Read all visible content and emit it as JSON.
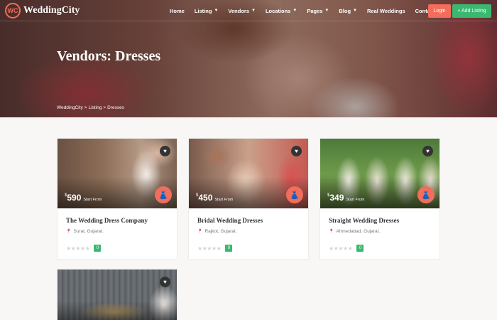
{
  "brand": {
    "name": "WeddingCity",
    "mark": "WC"
  },
  "nav": {
    "items": [
      {
        "label": "Home",
        "has_dropdown": false
      },
      {
        "label": "Listing",
        "has_dropdown": true
      },
      {
        "label": "Vendors",
        "has_dropdown": true
      },
      {
        "label": "Locations",
        "has_dropdown": true
      },
      {
        "label": "Pages",
        "has_dropdown": true
      },
      {
        "label": "Blog",
        "has_dropdown": true
      },
      {
        "label": "Real Weddings",
        "has_dropdown": false
      },
      {
        "label": "Contact Us",
        "has_dropdown": false
      }
    ],
    "login_label": "Login",
    "add_listing_label": "+ Add Listing"
  },
  "hero": {
    "title": "Vendors: Dresses",
    "breadcrumb": [
      "WeddingCity",
      ">",
      "Listing",
      ">",
      "Dresses"
    ]
  },
  "listings": [
    {
      "title": "The Wedding Dress Company",
      "location": "Surat, Gujarat.",
      "currency": "$",
      "price": "590",
      "price_suffix": "Start From",
      "stars": "★★★★★",
      "reviews": "0"
    },
    {
      "title": "Bridal Wedding Dresses",
      "location": "Rajkot, Gujarat.",
      "currency": "$",
      "price": "450",
      "price_suffix": "Start From",
      "stars": "★★★★★",
      "reviews": "0"
    },
    {
      "title": "Straight Wedding Dresses",
      "location": "Ahmedabad, Gujarat.",
      "currency": "$",
      "price": "349",
      "price_suffix": "Start From",
      "stars": "★★★★★",
      "reviews": "0"
    }
  ],
  "icons": {
    "heart": "heart-icon",
    "dress": "dress-icon",
    "pin": "map-pin-icon",
    "chevron": "chevron-down-icon"
  },
  "colors": {
    "accent": "#f26d5b",
    "success": "#3bb870"
  }
}
